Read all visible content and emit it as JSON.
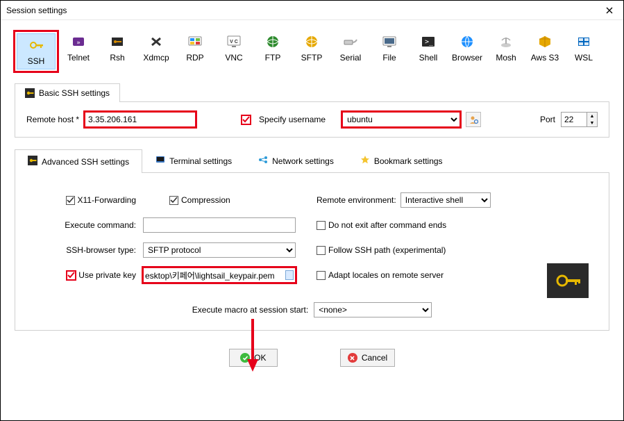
{
  "window": {
    "title": "Session settings"
  },
  "sessionTypes": [
    {
      "label": "SSH",
      "color": "#e6b800",
      "selected": true
    },
    {
      "label": "Telnet",
      "color": "#6b2c91"
    },
    {
      "label": "Rsh",
      "color": "#2a2a2a"
    },
    {
      "label": "Xdmcp",
      "color": "#e0e0e0"
    },
    {
      "label": "RDP",
      "color": "#1e90ff"
    },
    {
      "label": "VNC",
      "color": "#e0e0e0"
    },
    {
      "label": "FTP",
      "color": "#2e8b2e"
    },
    {
      "label": "SFTP",
      "color": "#e6a800"
    },
    {
      "label": "Serial",
      "color": "#808080"
    },
    {
      "label": "File",
      "color": "#707070"
    },
    {
      "label": "Shell",
      "color": "#2a2a2a"
    },
    {
      "label": "Browser",
      "color": "#1e90ff"
    },
    {
      "label": "Mosh",
      "color": "#b0b0b0"
    },
    {
      "label": "Aws S3",
      "color": "#e6a800"
    },
    {
      "label": "WSL",
      "color": "#0067c0"
    }
  ],
  "basicTab": {
    "label": "Basic SSH settings"
  },
  "basic": {
    "remoteHostLabel": "Remote host *",
    "remoteHost": "3.35.206.161",
    "specifyUsernameLabel": "Specify username",
    "specifyUsernameChecked": true,
    "username": "ubuntu",
    "portLabel": "Port",
    "port": "22"
  },
  "advTabs": {
    "advanced": "Advanced SSH settings",
    "terminal": "Terminal settings",
    "network": "Network settings",
    "bookmark": "Bookmark settings"
  },
  "adv": {
    "x11Label": "X11-Forwarding",
    "x11Checked": true,
    "compressionLabel": "Compression",
    "compressionChecked": true,
    "remoteEnvLabel": "Remote environment:",
    "remoteEnv": "Interactive shell",
    "execLabel": "Execute command:",
    "execValue": "",
    "doNotExitLabel": "Do not exit after command ends",
    "doNotExitChecked": false,
    "browserTypeLabel": "SSH-browser type:",
    "browserType": "SFTP protocol",
    "followSshLabel": "Follow SSH path (experimental)",
    "followSshChecked": false,
    "usePkLabel": "Use private key",
    "usePkChecked": true,
    "pkPath": "esktop\\키페어\\lightsail_keypair.pem",
    "adaptLocalesLabel": "Adapt locales on remote server",
    "adaptLocalesChecked": false,
    "macroLabel": "Execute macro at session start:",
    "macro": "<none>"
  },
  "buttons": {
    "ok": "OK",
    "cancel": "Cancel"
  }
}
